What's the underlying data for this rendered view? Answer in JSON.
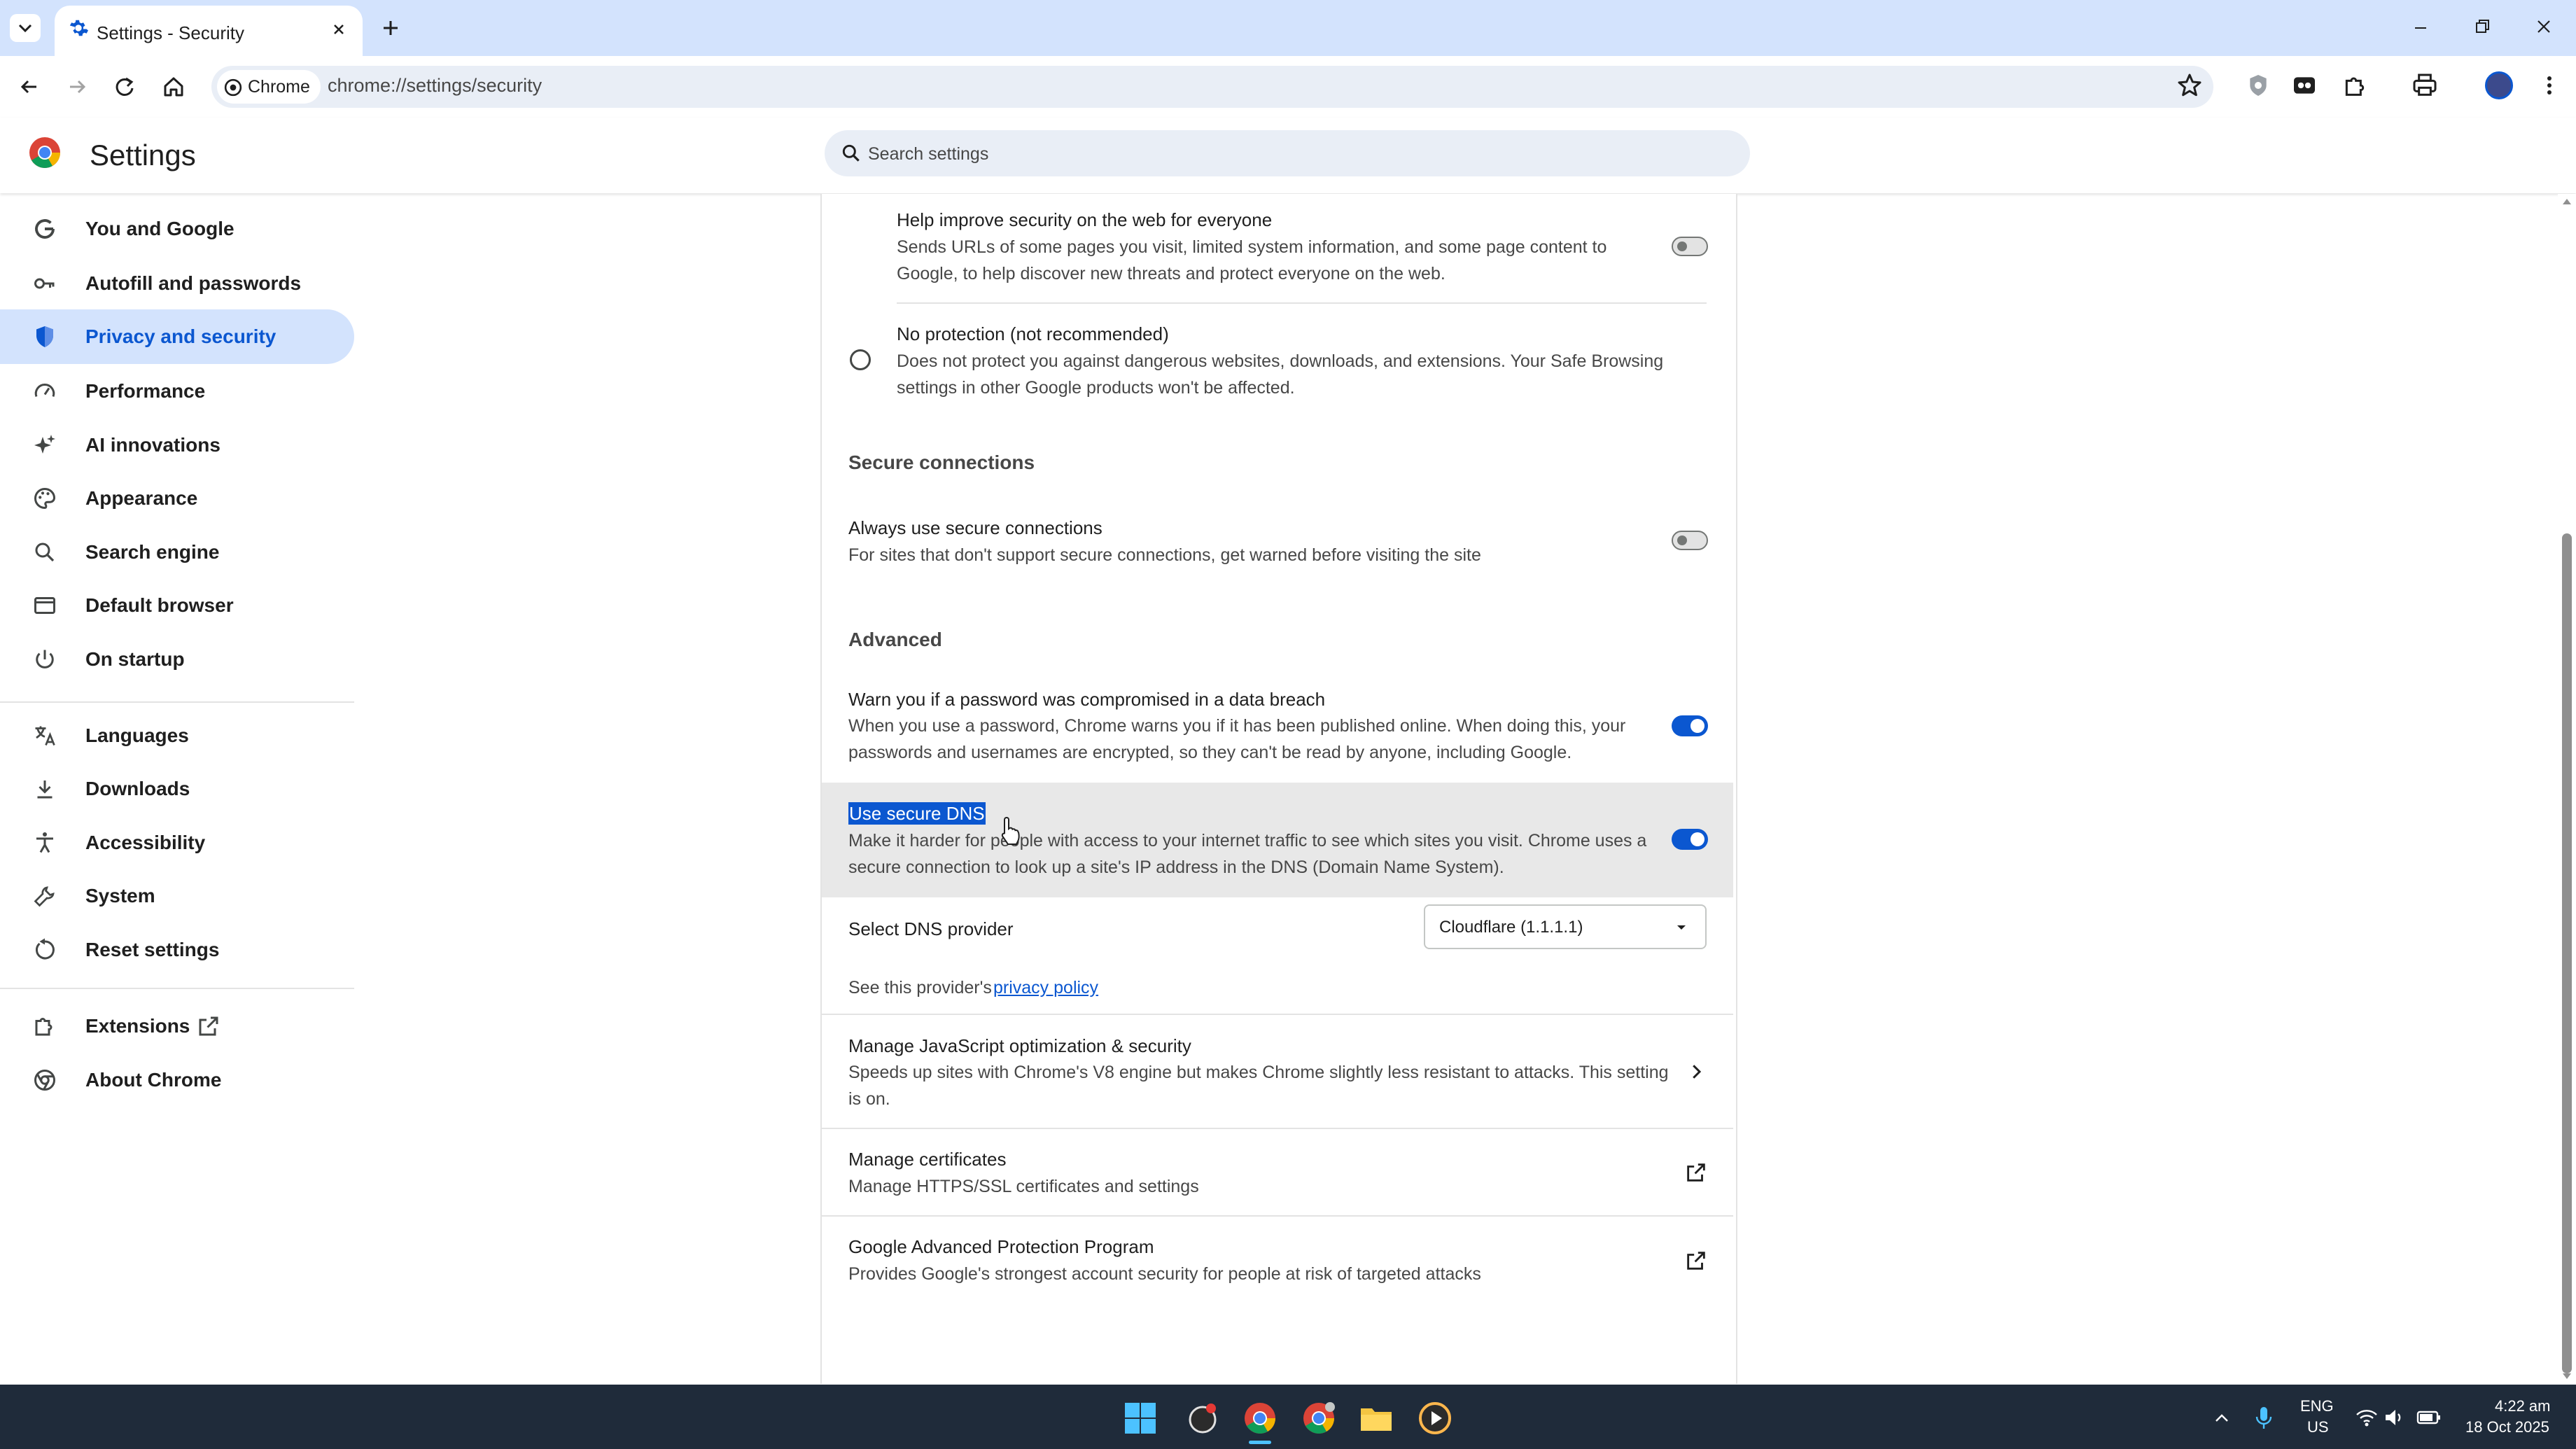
{
  "browser": {
    "tab": {
      "title": "Settings - Security"
    },
    "address": {
      "chip_label": "Chrome",
      "url": "chrome://settings/security"
    }
  },
  "settings": {
    "title": "Settings",
    "search_placeholder": "Search settings"
  },
  "sidebar": {
    "items": [
      {
        "label": "You and Google",
        "icon": "google-icon"
      },
      {
        "label": "Autofill and passwords",
        "icon": "key-icon"
      },
      {
        "label": "Privacy and security",
        "icon": "shield-icon",
        "active": true
      },
      {
        "label": "Performance",
        "icon": "speedometer-icon"
      },
      {
        "label": "AI innovations",
        "icon": "sparkle-icon"
      },
      {
        "label": "Appearance",
        "icon": "palette-icon"
      },
      {
        "label": "Search engine",
        "icon": "search-icon"
      },
      {
        "label": "Default browser",
        "icon": "browser-window-icon"
      },
      {
        "label": "On startup",
        "icon": "power-icon"
      },
      {
        "label": "Languages",
        "icon": "translate-icon"
      },
      {
        "label": "Downloads",
        "icon": "download-icon"
      },
      {
        "label": "Accessibility",
        "icon": "accessibility-icon"
      },
      {
        "label": "System",
        "icon": "wrench-icon"
      },
      {
        "label": "Reset settings",
        "icon": "reset-icon"
      },
      {
        "label": "Extensions",
        "icon": "puzzle-icon"
      },
      {
        "label": "About Chrome",
        "icon": "chrome-icon"
      }
    ]
  },
  "content": {
    "help_improve": {
      "title": "Help improve security on the web for everyone",
      "sub1": "Sends URLs of some pages you visit, limited system information, and some page content to",
      "sub2": "Google, to help discover new threats and protect everyone on the web.",
      "enabled": false
    },
    "no_protection": {
      "title": "No protection (not recommended)",
      "sub1": "Does not protect you against dangerous websites, downloads, and extensions. Your Safe Browsing",
      "sub2": "settings in other Google products won't be affected."
    },
    "secure_connections_heading": "Secure connections",
    "always_secure": {
      "title": "Always use secure connections",
      "sub": "For sites that don't support secure connections, get warned before visiting the site",
      "enabled": false
    },
    "advanced_heading": "Advanced",
    "password_breach": {
      "title": "Warn you if a password was compromised in a data breach",
      "sub1": "When you use a password, Chrome warns you if it has been published online. When doing this, your",
      "sub2": "passwords and usernames are encrypted, so they can't be read by anyone, including Google.",
      "enabled": true
    },
    "secure_dns": {
      "title": "Use secure DNS",
      "sub1": "Make it harder for people with access to your internet traffic to see which sites you visit. Chrome uses a",
      "sub2": "secure connection to look up a site's IP address in the DNS (Domain Name System).",
      "enabled": true
    },
    "dns_provider": {
      "label": "Select DNS provider",
      "selected": "Cloudflare (1.1.1.1)",
      "privacy_prefix": "See this provider's ",
      "privacy_link": "privacy policy"
    },
    "js_opt": {
      "title": "Manage JavaScript optimization & security",
      "sub1": "Speeds up sites with Chrome's V8 engine but makes Chrome slightly less resistant to attacks. This setting",
      "sub2": "is on."
    },
    "certificates": {
      "title": "Manage certificates",
      "sub": "Manage HTTPS/SSL certificates and settings"
    },
    "advanced_protection": {
      "title": "Google Advanced Protection Program",
      "sub": "Provides Google's strongest account security for people at risk of targeted attacks"
    }
  },
  "taskbar": {
    "lang_top": "ENG",
    "lang_bottom": "US",
    "time": "4:22 am",
    "date": "18 Oct 2025"
  },
  "colors": {
    "accent": "#0b57d0",
    "tabstrip": "#d3e3fd",
    "taskbar": "#1f2b3a"
  }
}
